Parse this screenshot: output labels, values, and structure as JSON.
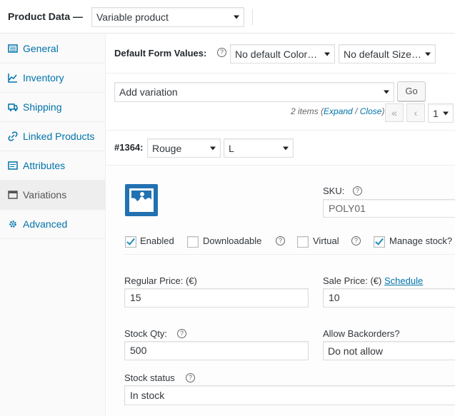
{
  "header": {
    "title": "Product Data —",
    "product_type": "Variable product"
  },
  "sidebar": {
    "items": [
      {
        "label": "General",
        "icon": "wrench-grid-icon"
      },
      {
        "label": "Inventory",
        "icon": "chart-icon"
      },
      {
        "label": "Shipping",
        "icon": "truck-icon"
      },
      {
        "label": "Linked Products",
        "icon": "link-icon"
      },
      {
        "label": "Attributes",
        "icon": "list-icon"
      },
      {
        "label": "Variations",
        "icon": "window-icon",
        "active": true
      },
      {
        "label": "Advanced",
        "icon": "gear-icon"
      }
    ]
  },
  "defaults": {
    "label": "Default Form Values:",
    "help": "?",
    "color_select": "No default Color…",
    "size_select": "No default Size…"
  },
  "variation_toolbar": {
    "action_select": "Add variation",
    "go_label": "Go",
    "items_count": "2 items",
    "expand_label": "Expand",
    "slash": " / ",
    "close_label": "Close",
    "first_page": "«",
    "prev_page": "‹",
    "page_select": "1"
  },
  "variation": {
    "id_label": "#1364:",
    "color_value": "Rouge",
    "size_value": "L",
    "sku_label": "SKU:",
    "sku_placeholder": "POLY01",
    "checkboxes": {
      "enabled": {
        "label": "Enabled",
        "checked": true
      },
      "downloadable": {
        "label": "Downloadable",
        "checked": false
      },
      "virtual": {
        "label": "Virtual",
        "checked": false
      },
      "manage_stock": {
        "label": "Manage stock?",
        "checked": true
      }
    },
    "regular_price_label": "Regular Price: (€)",
    "regular_price_value": "15",
    "sale_price_label": "Sale Price: (€)",
    "schedule_label": "Schedule",
    "sale_price_value": "10",
    "stock_qty_label": "Stock Qty:",
    "stock_qty_value": "500",
    "backorders_label": "Allow Backorders?",
    "backorders_value": "Do not allow",
    "stock_status_label": "Stock status",
    "stock_status_value": "In stock"
  },
  "colors": {
    "accent": "#0073aa",
    "image_blue": "#2271b1"
  }
}
